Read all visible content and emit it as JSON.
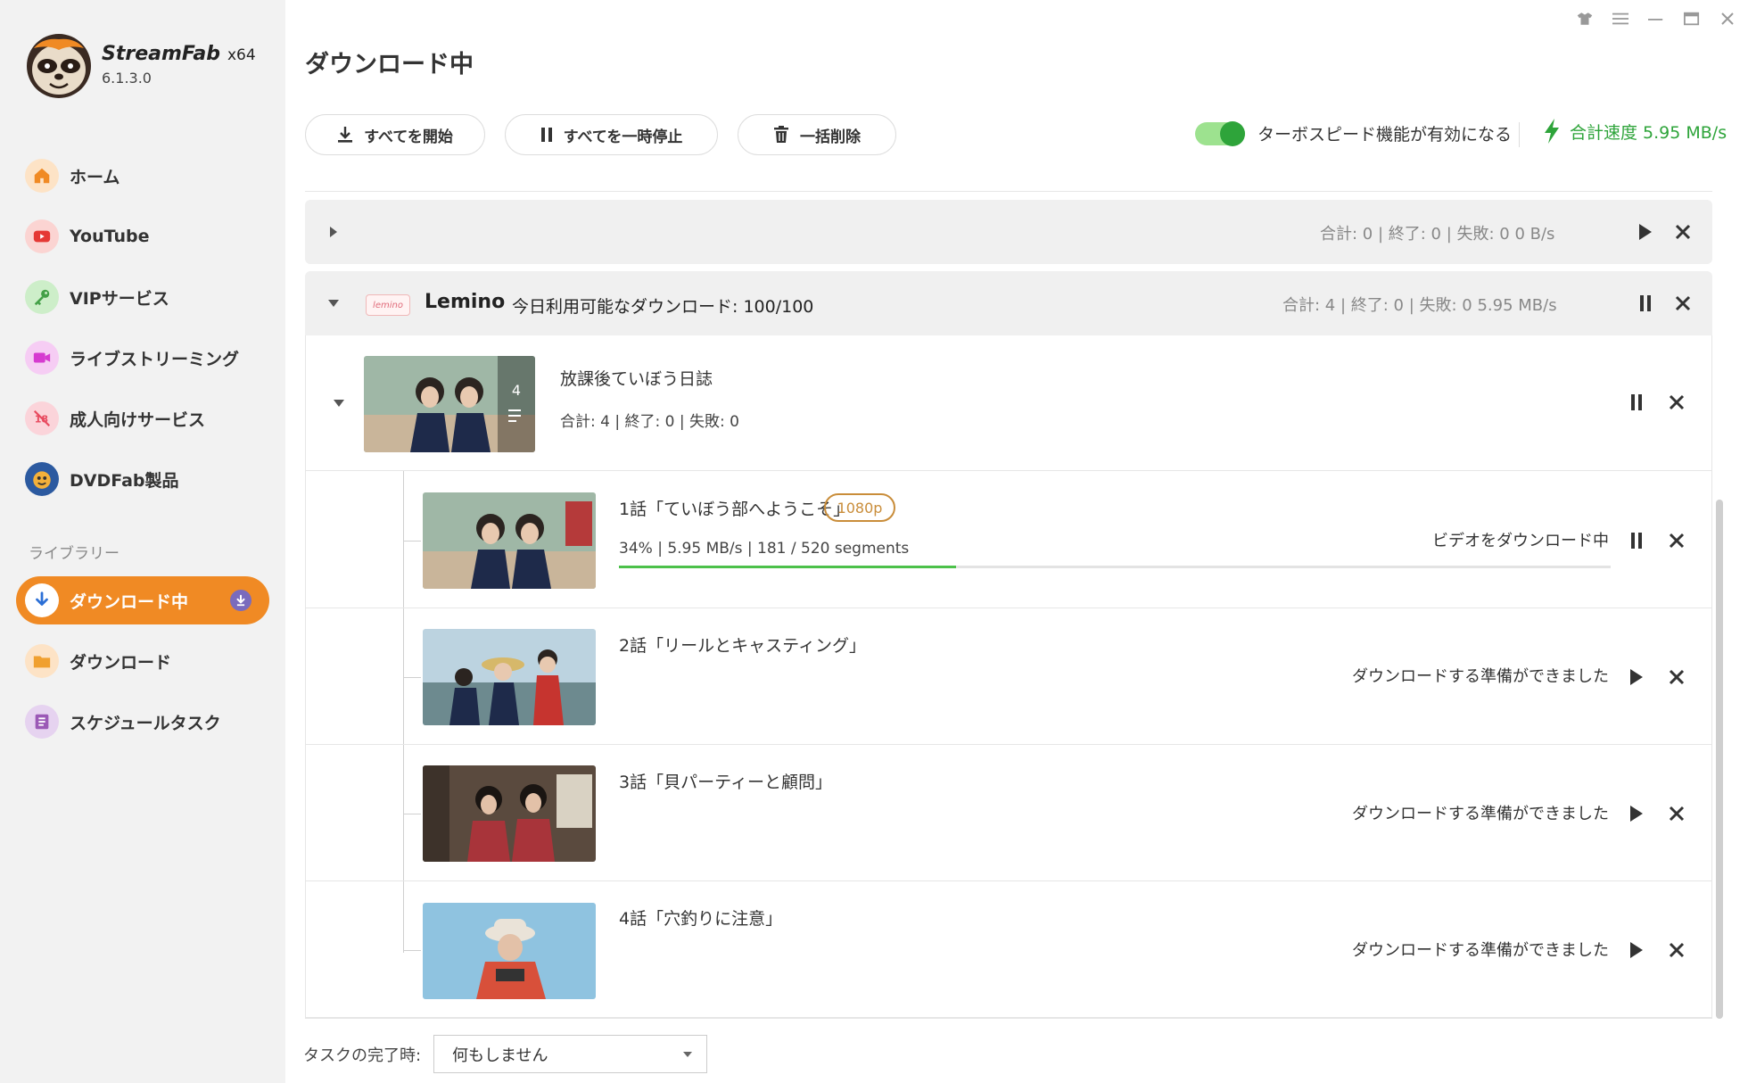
{
  "app": {
    "brand": "StreamFab",
    "arch": "x64",
    "version": "6.1.3.0"
  },
  "window_controls": [
    "shirt-icon",
    "menu-icon",
    "minimize-icon",
    "maximize-icon",
    "close-icon"
  ],
  "sidebar": {
    "items": [
      {
        "label": "ホーム",
        "icon": "home-icon",
        "color": "#f08a24"
      },
      {
        "label": "YouTube",
        "icon": "youtube-icon",
        "color": "#e53935"
      },
      {
        "label": "VIPサービス",
        "icon": "key-icon",
        "color": "#43a047"
      },
      {
        "label": "ライブストリーミング",
        "icon": "video-camera-icon",
        "color": "#d63bd0"
      },
      {
        "label": "成人向けサービス",
        "icon": "adult-icon",
        "color": "#e84a5f"
      },
      {
        "label": "DVDFab製品",
        "icon": "dvdfab-icon",
        "color": "#2c5aa0"
      }
    ],
    "library_title": "ライブラリー",
    "library": [
      {
        "label": "ダウンロード中",
        "icon": "download-arrow-icon",
        "active": true
      },
      {
        "label": "ダウンロード",
        "icon": "folder-icon",
        "color": "#f0a030"
      },
      {
        "label": "スケジュールタスク",
        "icon": "schedule-icon",
        "color": "#9b59b6"
      }
    ]
  },
  "header": {
    "title": "ダウンロード中",
    "start_all": "すべてを開始",
    "pause_all": "すべてを一時停止",
    "delete_all": "一括削除",
    "turbo_label": "ターボスピード機能が有効になる",
    "turbo_on": true,
    "speed_label": "合計速度 5.95 MB/s"
  },
  "groups": [
    {
      "stats": "合計: 0 | 終了: 0 | 失敗: 0    0 B/s"
    },
    {
      "service": "Lemino",
      "logo_text": "lemino",
      "quota": "今日利用可能なダウンロード: 100/100",
      "stats": "合計: 4 | 終了: 0 | 失敗: 0    5.95 MB/s",
      "series": {
        "title": "放課後ていぼう日誌",
        "count_badge": "4",
        "stats": "合計: 4  |  終了: 0  |  失敗: 0",
        "episodes": [
          {
            "title": "1話「ていぼう部へようこそ」",
            "resolution": "1080p",
            "progress_pct": 34,
            "stats": "34%  |  5.95 MB/s  |  181 / 520 segments",
            "status": "ビデオをダウンロード中",
            "state": "downloading"
          },
          {
            "title": "2話「リールとキャスティング」",
            "status": "ダウンロードする準備ができました",
            "state": "ready"
          },
          {
            "title": "3話「貝パーティーと顧問」",
            "status": "ダウンロードする準備ができました",
            "state": "ready"
          },
          {
            "title": "4話「穴釣りに注意」",
            "status": "ダウンロードする準備ができました",
            "state": "ready"
          }
        ]
      }
    }
  ],
  "footer": {
    "label": "タスクの完了時:",
    "select_value": "何もしません"
  },
  "colors": {
    "accent": "#f08a24",
    "green": "#2ea43a",
    "badge": "#c98d3a",
    "progress": "#4cc14a"
  }
}
